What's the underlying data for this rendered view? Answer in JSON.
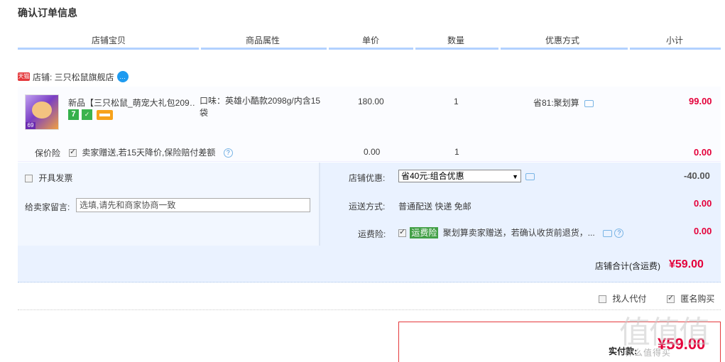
{
  "page_title": "确认订单信息",
  "columns": [
    "店铺宝贝",
    "商品属性",
    "单价",
    "数量",
    "优惠方式",
    "小计"
  ],
  "shop": {
    "badge": "天猫",
    "label": "店铺: 三只松鼠旗舰店",
    "ww_icon": "chat-bubble-icon"
  },
  "item": {
    "name": "新品【三只松鼠_萌宠大礼包209…",
    "thumb_tag": "69",
    "tag1": "7",
    "props": "口味：英雄小酷款2098g/内含15袋",
    "price": "180.00",
    "qty": "1",
    "promo": "省81:聚划算",
    "subtotal": "99.00"
  },
  "insurance_row": {
    "label": "保价险",
    "desc": "卖家赠送,若15天降价,保险赔付差额",
    "price": "0.00",
    "qty": "1",
    "subtotal": "0.00",
    "checked": true
  },
  "invoice": {
    "label": "开具发票",
    "checked": false
  },
  "shop_discount": {
    "label": "店铺优惠:",
    "selected": "省40元:组合优惠",
    "amount": "-40.00"
  },
  "message": {
    "label": "给卖家留言:",
    "placeholder": "选填,请先和商家协商一致"
  },
  "shipping": {
    "label": "运送方式:",
    "value": "普通配送 快递 免邮",
    "amount": "0.00"
  },
  "freight_insurance": {
    "label": "运费险:",
    "badge": "运费险",
    "desc": "聚划算卖家赠送，若确认收货前退货，...",
    "amount": "0.00",
    "checked": true
  },
  "shop_total": {
    "label": "店铺合计(含运费)",
    "amount": "¥59.00"
  },
  "options": {
    "proxy_pay": {
      "label": "找人代付",
      "checked": false
    },
    "anonymous": {
      "label": "匿名购买",
      "checked": true
    }
  },
  "grand_total": {
    "label": "实付款:",
    "amount": "¥59.00"
  },
  "watermark": {
    "big": "值值值",
    "small": "什么值得买"
  },
  "colors": {
    "accent_red": "#e4003a",
    "header_line": "#b2d1ff",
    "band": "#eaf2ff"
  }
}
